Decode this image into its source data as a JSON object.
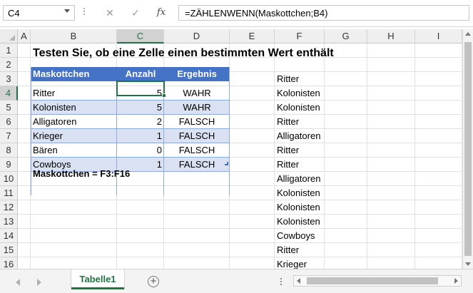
{
  "formula_bar": {
    "name_box": "C4",
    "cancel_icon": "✕",
    "enter_icon": "✓",
    "fx_label": "fx",
    "formula": "=ZÄHLENWENN(Maskottchen;B4)"
  },
  "columns": [
    "A",
    "B",
    "C",
    "D",
    "E",
    "F",
    "G",
    "H",
    "I"
  ],
  "rows": [
    "1",
    "2",
    "3",
    "4",
    "5",
    "6",
    "7",
    "8",
    "9",
    "10",
    "11",
    "12",
    "13",
    "14",
    "15",
    "16"
  ],
  "selected_cell": "C4",
  "title": "Testen Sie, ob eine Zelle einen bestimmten Wert enthält",
  "table": {
    "headers": [
      "Maskottchen",
      "Anzahl",
      "Ergebnis"
    ],
    "rows": [
      {
        "name": "Ritter",
        "count": "5",
        "result": "WAHR"
      },
      {
        "name": "Kolonisten",
        "count": "5",
        "result": "WAHR"
      },
      {
        "name": "Alligatoren",
        "count": "2",
        "result": "FALSCH"
      },
      {
        "name": "Krieger",
        "count": "1",
        "result": "FALSCH"
      },
      {
        "name": "Bären",
        "count": "0",
        "result": "FALSCH"
      },
      {
        "name": "Cowboys",
        "count": "1",
        "result": "FALSCH"
      }
    ],
    "header_color": "#4472c4",
    "band_color": "#d9e1f2"
  },
  "note": "Maskottchen = F3:F16",
  "mascot_list": [
    "Ritter",
    "Kolonisten",
    "Kolonisten",
    "Ritter",
    "Alligatoren",
    "Ritter",
    "Ritter",
    "Alligatoren",
    "Kolonisten",
    "Kolonisten",
    "Kolonisten",
    "Cowboys",
    "Ritter",
    "Krieger"
  ],
  "sheet_tabs": [
    "Tabelle1"
  ],
  "add_sheet_icon": "+",
  "accent_color": "#217346"
}
